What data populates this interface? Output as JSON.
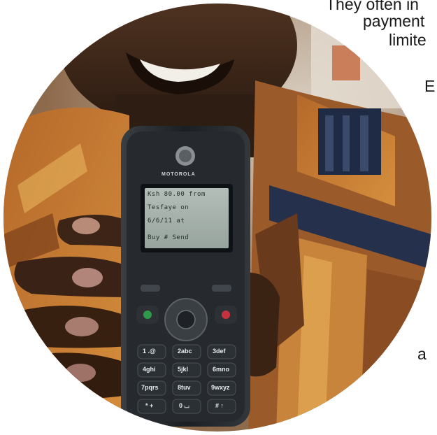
{
  "background_text": {
    "line1": "They often in",
    "line2": "payment",
    "line3": "limite",
    "line4": "E",
    "line5": "a"
  },
  "phone": {
    "brand": "MOTOROLA",
    "screen_lines": [
      "Ksh 80.00 from",
      "Tesfaye on",
      "6/6/11 at",
      "Buy    #    Send"
    ],
    "keys": [
      "1 .@",
      "2abc",
      "3def",
      "4ghi",
      "5jkl",
      "6mno",
      "7pqrs",
      "8tuv",
      "9wxyz",
      "* +",
      "0 ⌴",
      "# ↑"
    ]
  },
  "colors": {
    "skin": "#3b2416",
    "shirt_orange": "#c9772b",
    "shirt_stripe": "#1f2b44",
    "phone_body": "#24282c",
    "screen": "#a7b2ad",
    "call_green": "#2f9a4a",
    "end_red": "#c6323e"
  }
}
